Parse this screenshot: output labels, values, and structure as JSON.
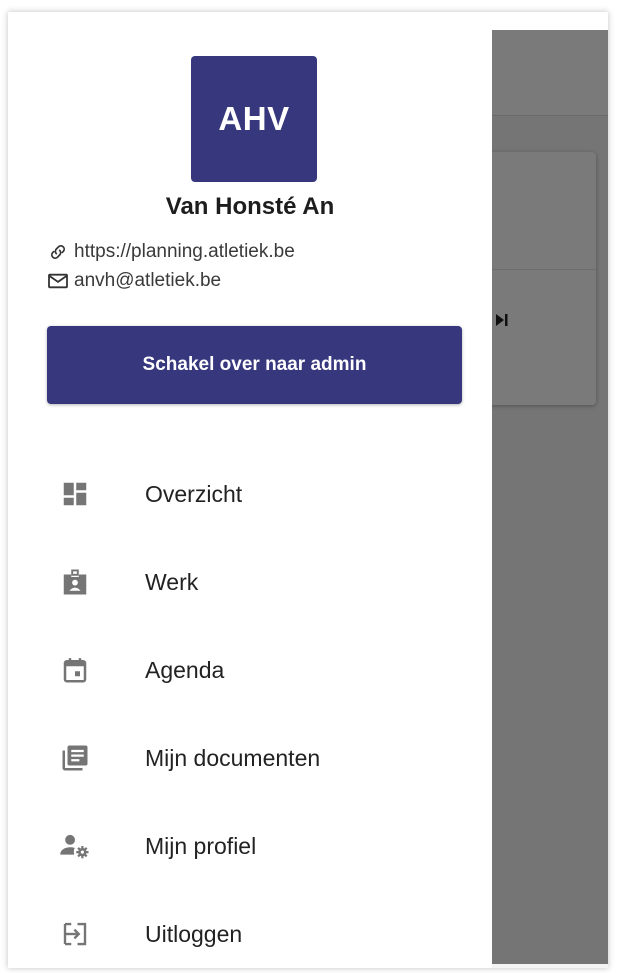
{
  "profile": {
    "initials": "AHV",
    "name": "Van Honsté An",
    "url": "https://planning.atletiek.be",
    "email": "anvh@atletiek.be",
    "avatar_color": "#37377e"
  },
  "admin_button": {
    "label": "Schakel over naar admin",
    "color": "#37377e"
  },
  "menu": {
    "items": [
      {
        "label": "Overzicht",
        "icon": "dashboard-icon"
      },
      {
        "label": "Werk",
        "icon": "badge-icon"
      },
      {
        "label": "Agenda",
        "icon": "calendar-icon"
      },
      {
        "label": "Mijn documenten",
        "icon": "documents-icon"
      },
      {
        "label": "Mijn profiel",
        "icon": "profile-settings-icon"
      },
      {
        "label": "Uitloggen",
        "icon": "logout-icon"
      }
    ]
  },
  "colors": {
    "icon_gray": "#757575",
    "scrim": "rgba(0,0,0,0.52)"
  }
}
